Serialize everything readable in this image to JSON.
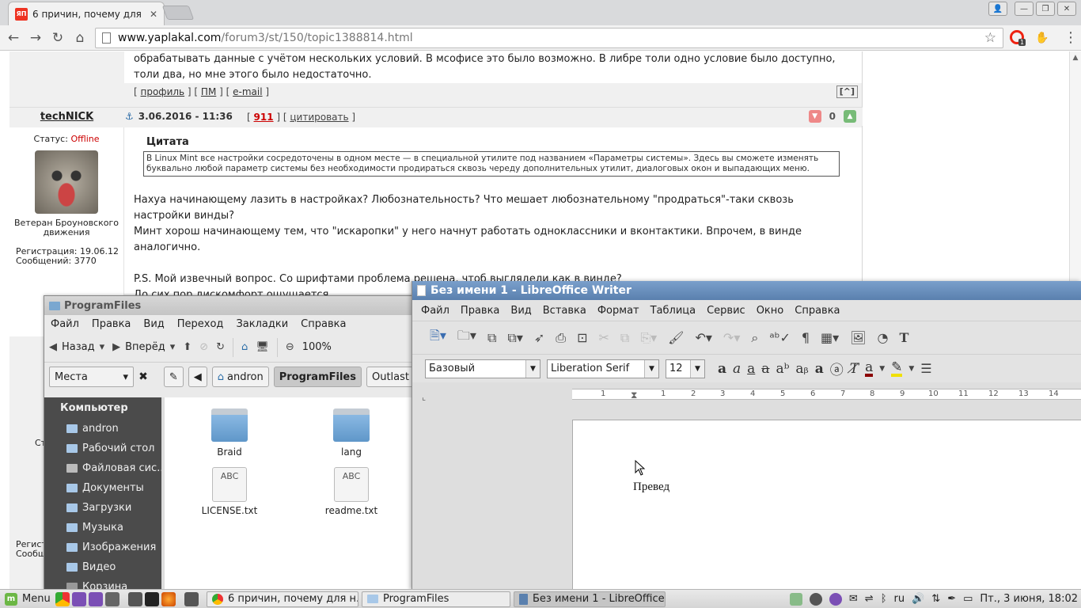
{
  "browser": {
    "tab_title": "6 причин, почему для",
    "tab_favicon": "ЯП",
    "url_host": "www.yaplakal.com",
    "url_path": "/forum3/st/150/topic1388814.html",
    "ext_badge": "1"
  },
  "forum": {
    "prev_post_text": "обрабатывать данные с учётом нескольких условий. В мсофисе это было возможно. В либре толи одно условие было доступно, толи два, но мне этого было недостаточно.",
    "links": {
      "profile": "профиль",
      "pm": "ПМ",
      "email": "e-mail",
      "up": "[^]"
    },
    "post": {
      "username": "techNICK",
      "datetime": "3.06.2016 - 11:36",
      "post_number": "911",
      "quote_link": "цитировать",
      "rating": "0",
      "status_label": "Статус:",
      "status_value": "Offline",
      "rank": "Ветеран Броуновского движения",
      "registration": "Регистрация: 19.06.12",
      "messages": "Сообщений: 3770",
      "quote_title": "Цитата",
      "quote_text": "В Linux Mint все настройки сосредоточены в одном месте — в специальной утилите под названием «Параметры системы». Здесь вы сможете изменять буквально любой параметр системы без необходимости продираться сквозь череду дополнительных утилит, диалоговых окон и выпадающих меню.",
      "line1": "Нахуа начинающему лазить в настройках? Любознательность? Что мешает любознательному \"продраться\"-таки сквозь настройки винды?",
      "line2": "Минт хорош начинающему тем, что \"искаропки\" у него начнут работать одноклассники и вконтактики. Впрочем, в винде аналогично.",
      "line3": "P.S. Мой извечный вопрос. Со шрифтами проблема решена, чтоб выглядели как в винде?",
      "line4": "До сих пор дискомфорт ощущается."
    },
    "side_frag_1": "Ст",
    "side_frag_2": "Регист",
    "side_frag_3": "Сообщ"
  },
  "file_manager": {
    "title": "ProgramFiles",
    "menu": [
      "Файл",
      "Правка",
      "Вид",
      "Переход",
      "Закладки",
      "Справка"
    ],
    "back": "Назад",
    "forward": "Вперёд",
    "zoom": "100%",
    "places": "Места",
    "path": [
      "andron",
      "ProgramFiles",
      "Outlast"
    ],
    "sidebar_head": "Компьютер",
    "sidebar": [
      "andron",
      "Рабочий стол",
      "Файловая сис...",
      "Документы",
      "Загрузки",
      "Музыка",
      "Изображения",
      "Видео",
      "Корзина"
    ],
    "files": [
      {
        "name": "Braid",
        "kind": "folder"
      },
      {
        "name": "lang",
        "kind": "folder"
      },
      {
        "name": "LICENSE.txt",
        "kind": "text"
      },
      {
        "name": "readme.txt",
        "kind": "text"
      }
    ],
    "txt_thumb": "ABC"
  },
  "writer": {
    "title": "Без имени 1 - LibreOffice Writer",
    "menu": [
      "Файл",
      "Правка",
      "Вид",
      "Вставка",
      "Формат",
      "Таблица",
      "Сервис",
      "Окно",
      "Справка"
    ],
    "style": "Базовый",
    "font": "Liberation Serif",
    "size": "12",
    "ruler": [
      "1",
      "1",
      "2",
      "3",
      "4",
      "5",
      "6",
      "7",
      "8",
      "9",
      "10",
      "11",
      "12",
      "13",
      "14"
    ],
    "doc_text": "Превед",
    "colors": {
      "font_color": "#8b0000",
      "highlight": "#f0e000"
    }
  },
  "taskbar": {
    "menu": "Menu",
    "windows": [
      "6 причин, почему для н...",
      "ProgramFiles",
      "Без имени 1 - LibreOffice..."
    ],
    "lang": "ru",
    "clock": "Пт., 3 июня, 18:02"
  }
}
